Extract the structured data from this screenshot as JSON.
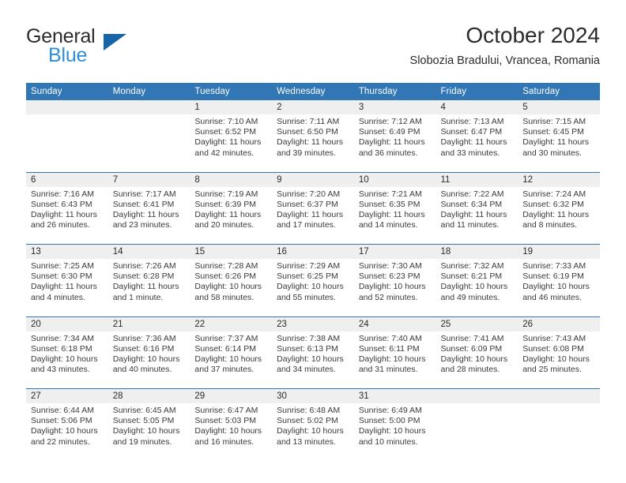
{
  "brand": {
    "name_part1": "General",
    "name_part2": "Blue",
    "triangle_color": "#1565a8",
    "blue_text_color": "#2e8fd8"
  },
  "header": {
    "month_title": "October 2024",
    "location": "Slobozia Bradului, Vrancea, Romania",
    "header_bg_color": "#3176b5",
    "number_strip_color": "#efefef"
  },
  "weekday_headers": [
    "Sunday",
    "Monday",
    "Tuesday",
    "Wednesday",
    "Thursday",
    "Friday",
    "Saturday"
  ],
  "weeks": [
    {
      "days": [
        {
          "date": "",
          "sunrise": "",
          "sunset": "",
          "daylight1": "",
          "daylight2": ""
        },
        {
          "date": "",
          "sunrise": "",
          "sunset": "",
          "daylight1": "",
          "daylight2": ""
        },
        {
          "date": "1",
          "sunrise": "Sunrise: 7:10 AM",
          "sunset": "Sunset: 6:52 PM",
          "daylight1": "Daylight: 11 hours",
          "daylight2": "and 42 minutes."
        },
        {
          "date": "2",
          "sunrise": "Sunrise: 7:11 AM",
          "sunset": "Sunset: 6:50 PM",
          "daylight1": "Daylight: 11 hours",
          "daylight2": "and 39 minutes."
        },
        {
          "date": "3",
          "sunrise": "Sunrise: 7:12 AM",
          "sunset": "Sunset: 6:49 PM",
          "daylight1": "Daylight: 11 hours",
          "daylight2": "and 36 minutes."
        },
        {
          "date": "4",
          "sunrise": "Sunrise: 7:13 AM",
          "sunset": "Sunset: 6:47 PM",
          "daylight1": "Daylight: 11 hours",
          "daylight2": "and 33 minutes."
        },
        {
          "date": "5",
          "sunrise": "Sunrise: 7:15 AM",
          "sunset": "Sunset: 6:45 PM",
          "daylight1": "Daylight: 11 hours",
          "daylight2": "and 30 minutes."
        }
      ]
    },
    {
      "days": [
        {
          "date": "6",
          "sunrise": "Sunrise: 7:16 AM",
          "sunset": "Sunset: 6:43 PM",
          "daylight1": "Daylight: 11 hours",
          "daylight2": "and 26 minutes."
        },
        {
          "date": "7",
          "sunrise": "Sunrise: 7:17 AM",
          "sunset": "Sunset: 6:41 PM",
          "daylight1": "Daylight: 11 hours",
          "daylight2": "and 23 minutes."
        },
        {
          "date": "8",
          "sunrise": "Sunrise: 7:19 AM",
          "sunset": "Sunset: 6:39 PM",
          "daylight1": "Daylight: 11 hours",
          "daylight2": "and 20 minutes."
        },
        {
          "date": "9",
          "sunrise": "Sunrise: 7:20 AM",
          "sunset": "Sunset: 6:37 PM",
          "daylight1": "Daylight: 11 hours",
          "daylight2": "and 17 minutes."
        },
        {
          "date": "10",
          "sunrise": "Sunrise: 7:21 AM",
          "sunset": "Sunset: 6:35 PM",
          "daylight1": "Daylight: 11 hours",
          "daylight2": "and 14 minutes."
        },
        {
          "date": "11",
          "sunrise": "Sunrise: 7:22 AM",
          "sunset": "Sunset: 6:34 PM",
          "daylight1": "Daylight: 11 hours",
          "daylight2": "and 11 minutes."
        },
        {
          "date": "12",
          "sunrise": "Sunrise: 7:24 AM",
          "sunset": "Sunset: 6:32 PM",
          "daylight1": "Daylight: 11 hours",
          "daylight2": "and 8 minutes."
        }
      ]
    },
    {
      "days": [
        {
          "date": "13",
          "sunrise": "Sunrise: 7:25 AM",
          "sunset": "Sunset: 6:30 PM",
          "daylight1": "Daylight: 11 hours",
          "daylight2": "and 4 minutes."
        },
        {
          "date": "14",
          "sunrise": "Sunrise: 7:26 AM",
          "sunset": "Sunset: 6:28 PM",
          "daylight1": "Daylight: 11 hours",
          "daylight2": "and 1 minute."
        },
        {
          "date": "15",
          "sunrise": "Sunrise: 7:28 AM",
          "sunset": "Sunset: 6:26 PM",
          "daylight1": "Daylight: 10 hours",
          "daylight2": "and 58 minutes."
        },
        {
          "date": "16",
          "sunrise": "Sunrise: 7:29 AM",
          "sunset": "Sunset: 6:25 PM",
          "daylight1": "Daylight: 10 hours",
          "daylight2": "and 55 minutes."
        },
        {
          "date": "17",
          "sunrise": "Sunrise: 7:30 AM",
          "sunset": "Sunset: 6:23 PM",
          "daylight1": "Daylight: 10 hours",
          "daylight2": "and 52 minutes."
        },
        {
          "date": "18",
          "sunrise": "Sunrise: 7:32 AM",
          "sunset": "Sunset: 6:21 PM",
          "daylight1": "Daylight: 10 hours",
          "daylight2": "and 49 minutes."
        },
        {
          "date": "19",
          "sunrise": "Sunrise: 7:33 AM",
          "sunset": "Sunset: 6:19 PM",
          "daylight1": "Daylight: 10 hours",
          "daylight2": "and 46 minutes."
        }
      ]
    },
    {
      "days": [
        {
          "date": "20",
          "sunrise": "Sunrise: 7:34 AM",
          "sunset": "Sunset: 6:18 PM",
          "daylight1": "Daylight: 10 hours",
          "daylight2": "and 43 minutes."
        },
        {
          "date": "21",
          "sunrise": "Sunrise: 7:36 AM",
          "sunset": "Sunset: 6:16 PM",
          "daylight1": "Daylight: 10 hours",
          "daylight2": "and 40 minutes."
        },
        {
          "date": "22",
          "sunrise": "Sunrise: 7:37 AM",
          "sunset": "Sunset: 6:14 PM",
          "daylight1": "Daylight: 10 hours",
          "daylight2": "and 37 minutes."
        },
        {
          "date": "23",
          "sunrise": "Sunrise: 7:38 AM",
          "sunset": "Sunset: 6:13 PM",
          "daylight1": "Daylight: 10 hours",
          "daylight2": "and 34 minutes."
        },
        {
          "date": "24",
          "sunrise": "Sunrise: 7:40 AM",
          "sunset": "Sunset: 6:11 PM",
          "daylight1": "Daylight: 10 hours",
          "daylight2": "and 31 minutes."
        },
        {
          "date": "25",
          "sunrise": "Sunrise: 7:41 AM",
          "sunset": "Sunset: 6:09 PM",
          "daylight1": "Daylight: 10 hours",
          "daylight2": "and 28 minutes."
        },
        {
          "date": "26",
          "sunrise": "Sunrise: 7:43 AM",
          "sunset": "Sunset: 6:08 PM",
          "daylight1": "Daylight: 10 hours",
          "daylight2": "and 25 minutes."
        }
      ]
    },
    {
      "days": [
        {
          "date": "27",
          "sunrise": "Sunrise: 6:44 AM",
          "sunset": "Sunset: 5:06 PM",
          "daylight1": "Daylight: 10 hours",
          "daylight2": "and 22 minutes."
        },
        {
          "date": "28",
          "sunrise": "Sunrise: 6:45 AM",
          "sunset": "Sunset: 5:05 PM",
          "daylight1": "Daylight: 10 hours",
          "daylight2": "and 19 minutes."
        },
        {
          "date": "29",
          "sunrise": "Sunrise: 6:47 AM",
          "sunset": "Sunset: 5:03 PM",
          "daylight1": "Daylight: 10 hours",
          "daylight2": "and 16 minutes."
        },
        {
          "date": "30",
          "sunrise": "Sunrise: 6:48 AM",
          "sunset": "Sunset: 5:02 PM",
          "daylight1": "Daylight: 10 hours",
          "daylight2": "and 13 minutes."
        },
        {
          "date": "31",
          "sunrise": "Sunrise: 6:49 AM",
          "sunset": "Sunset: 5:00 PM",
          "daylight1": "Daylight: 10 hours",
          "daylight2": "and 10 minutes."
        },
        {
          "date": "",
          "sunrise": "",
          "sunset": "",
          "daylight1": "",
          "daylight2": ""
        },
        {
          "date": "",
          "sunrise": "",
          "sunset": "",
          "daylight1": "",
          "daylight2": ""
        }
      ]
    }
  ]
}
